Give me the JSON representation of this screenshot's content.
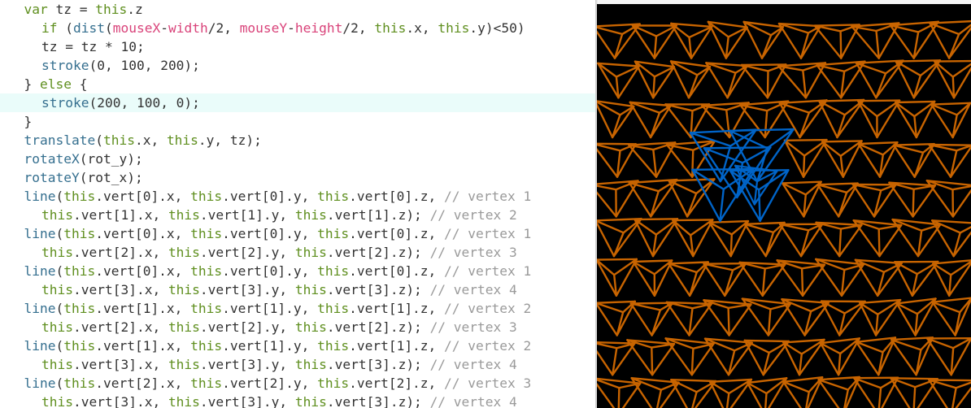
{
  "editor": {
    "active_line_index": 5,
    "lines": [
      {
        "indent": 1,
        "tokens": [
          {
            "t": "kw",
            "v": "var"
          },
          {
            "t": "pl",
            "v": " tz = "
          },
          {
            "t": "kw",
            "v": "this"
          },
          {
            "t": "pl",
            "v": ".z"
          }
        ]
      },
      {
        "indent": 2,
        "tokens": [
          {
            "t": "kw",
            "v": "if"
          },
          {
            "t": "pl",
            "v": " ("
          },
          {
            "t": "fn",
            "v": "dist"
          },
          {
            "t": "pl",
            "v": "("
          },
          {
            "t": "pk",
            "v": "mouseX"
          },
          {
            "t": "pl",
            "v": "-"
          },
          {
            "t": "pk",
            "v": "width"
          },
          {
            "t": "pl",
            "v": "/2, "
          },
          {
            "t": "pk",
            "v": "mouseY"
          },
          {
            "t": "pl",
            "v": "-"
          },
          {
            "t": "pk",
            "v": "height"
          },
          {
            "t": "pl",
            "v": "/2, "
          },
          {
            "t": "kw",
            "v": "this"
          },
          {
            "t": "pl",
            "v": ".x, "
          },
          {
            "t": "kw",
            "v": "this"
          },
          {
            "t": "pl",
            "v": ".y)<50)"
          }
        ]
      },
      {
        "indent": 2,
        "tokens": [
          {
            "t": "pl",
            "v": "tz = tz * 10;"
          }
        ]
      },
      {
        "indent": 2,
        "tokens": [
          {
            "t": "fn",
            "v": "stroke"
          },
          {
            "t": "pl",
            "v": "(0, 100, 200);"
          }
        ]
      },
      {
        "indent": 1,
        "tokens": [
          {
            "t": "pl",
            "v": "} "
          },
          {
            "t": "kw",
            "v": "else"
          },
          {
            "t": "pl",
            "v": " {"
          }
        ]
      },
      {
        "indent": 2,
        "tokens": [
          {
            "t": "fn",
            "v": "stroke"
          },
          {
            "t": "pl",
            "v": "(200, 100, 0);"
          }
        ]
      },
      {
        "indent": 1,
        "tokens": [
          {
            "t": "pl",
            "v": "}"
          }
        ]
      },
      {
        "indent": 1,
        "tokens": [
          {
            "t": "fn",
            "v": "translate"
          },
          {
            "t": "pl",
            "v": "("
          },
          {
            "t": "kw",
            "v": "this"
          },
          {
            "t": "pl",
            "v": ".x, "
          },
          {
            "t": "kw",
            "v": "this"
          },
          {
            "t": "pl",
            "v": ".y, tz);"
          }
        ]
      },
      {
        "indent": 1,
        "tokens": [
          {
            "t": "fn",
            "v": "rotateX"
          },
          {
            "t": "pl",
            "v": "(rot_y);"
          }
        ]
      },
      {
        "indent": 1,
        "tokens": [
          {
            "t": "fn",
            "v": "rotateY"
          },
          {
            "t": "pl",
            "v": "(rot_x);"
          }
        ]
      },
      {
        "indent": 1,
        "tokens": [
          {
            "t": "fn",
            "v": "line"
          },
          {
            "t": "pl",
            "v": "("
          },
          {
            "t": "kw",
            "v": "this"
          },
          {
            "t": "pl",
            "v": ".vert[0].x, "
          },
          {
            "t": "kw",
            "v": "this"
          },
          {
            "t": "pl",
            "v": ".vert[0].y, "
          },
          {
            "t": "kw",
            "v": "this"
          },
          {
            "t": "pl",
            "v": ".vert[0].z, "
          },
          {
            "t": "cm",
            "v": "// vertex 1"
          }
        ]
      },
      {
        "indent": 2,
        "tokens": [
          {
            "t": "kw",
            "v": "this"
          },
          {
            "t": "pl",
            "v": ".vert[1].x, "
          },
          {
            "t": "kw",
            "v": "this"
          },
          {
            "t": "pl",
            "v": ".vert[1].y, "
          },
          {
            "t": "kw",
            "v": "this"
          },
          {
            "t": "pl",
            "v": ".vert[1].z); "
          },
          {
            "t": "cm",
            "v": "// vertex 2"
          }
        ]
      },
      {
        "indent": 1,
        "tokens": [
          {
            "t": "fn",
            "v": "line"
          },
          {
            "t": "pl",
            "v": "("
          },
          {
            "t": "kw",
            "v": "this"
          },
          {
            "t": "pl",
            "v": ".vert[0].x, "
          },
          {
            "t": "kw",
            "v": "this"
          },
          {
            "t": "pl",
            "v": ".vert[0].y, "
          },
          {
            "t": "kw",
            "v": "this"
          },
          {
            "t": "pl",
            "v": ".vert[0].z, "
          },
          {
            "t": "cm",
            "v": "// vertex 1"
          }
        ]
      },
      {
        "indent": 2,
        "tokens": [
          {
            "t": "kw",
            "v": "this"
          },
          {
            "t": "pl",
            "v": ".vert[2].x, "
          },
          {
            "t": "kw",
            "v": "this"
          },
          {
            "t": "pl",
            "v": ".vert[2].y, "
          },
          {
            "t": "kw",
            "v": "this"
          },
          {
            "t": "pl",
            "v": ".vert[2].z); "
          },
          {
            "t": "cm",
            "v": "// vertex 3"
          }
        ]
      },
      {
        "indent": 1,
        "tokens": [
          {
            "t": "fn",
            "v": "line"
          },
          {
            "t": "pl",
            "v": "("
          },
          {
            "t": "kw",
            "v": "this"
          },
          {
            "t": "pl",
            "v": ".vert[0].x, "
          },
          {
            "t": "kw",
            "v": "this"
          },
          {
            "t": "pl",
            "v": ".vert[0].y, "
          },
          {
            "t": "kw",
            "v": "this"
          },
          {
            "t": "pl",
            "v": ".vert[0].z, "
          },
          {
            "t": "cm",
            "v": "// vertex 1"
          }
        ]
      },
      {
        "indent": 2,
        "tokens": [
          {
            "t": "kw",
            "v": "this"
          },
          {
            "t": "pl",
            "v": ".vert[3].x, "
          },
          {
            "t": "kw",
            "v": "this"
          },
          {
            "t": "pl",
            "v": ".vert[3].y, "
          },
          {
            "t": "kw",
            "v": "this"
          },
          {
            "t": "pl",
            "v": ".vert[3].z); "
          },
          {
            "t": "cm",
            "v": "// vertex 4"
          }
        ]
      },
      {
        "indent": 1,
        "tokens": [
          {
            "t": "fn",
            "v": "line"
          },
          {
            "t": "pl",
            "v": "("
          },
          {
            "t": "kw",
            "v": "this"
          },
          {
            "t": "pl",
            "v": ".vert[1].x, "
          },
          {
            "t": "kw",
            "v": "this"
          },
          {
            "t": "pl",
            "v": ".vert[1].y, "
          },
          {
            "t": "kw",
            "v": "this"
          },
          {
            "t": "pl",
            "v": ".vert[1].z, "
          },
          {
            "t": "cm",
            "v": "// vertex 2"
          }
        ]
      },
      {
        "indent": 2,
        "tokens": [
          {
            "t": "kw",
            "v": "this"
          },
          {
            "t": "pl",
            "v": ".vert[2].x, "
          },
          {
            "t": "kw",
            "v": "this"
          },
          {
            "t": "pl",
            "v": ".vert[2].y, "
          },
          {
            "t": "kw",
            "v": "this"
          },
          {
            "t": "pl",
            "v": ".vert[2].z); "
          },
          {
            "t": "cm",
            "v": "// vertex 3"
          }
        ]
      },
      {
        "indent": 1,
        "tokens": [
          {
            "t": "fn",
            "v": "line"
          },
          {
            "t": "pl",
            "v": "("
          },
          {
            "t": "kw",
            "v": "this"
          },
          {
            "t": "pl",
            "v": ".vert[1].x, "
          },
          {
            "t": "kw",
            "v": "this"
          },
          {
            "t": "pl",
            "v": ".vert[1].y, "
          },
          {
            "t": "kw",
            "v": "this"
          },
          {
            "t": "pl",
            "v": ".vert[1].z, "
          },
          {
            "t": "cm",
            "v": "// vertex 2"
          }
        ]
      },
      {
        "indent": 2,
        "tokens": [
          {
            "t": "kw",
            "v": "this"
          },
          {
            "t": "pl",
            "v": ".vert[3].x, "
          },
          {
            "t": "kw",
            "v": "this"
          },
          {
            "t": "pl",
            "v": ".vert[3].y, "
          },
          {
            "t": "kw",
            "v": "this"
          },
          {
            "t": "pl",
            "v": ".vert[3].z); "
          },
          {
            "t": "cm",
            "v": "// vertex 4"
          }
        ]
      },
      {
        "indent": 1,
        "tokens": [
          {
            "t": "fn",
            "v": "line"
          },
          {
            "t": "pl",
            "v": "("
          },
          {
            "t": "kw",
            "v": "this"
          },
          {
            "t": "pl",
            "v": ".vert[2].x, "
          },
          {
            "t": "kw",
            "v": "this"
          },
          {
            "t": "pl",
            "v": ".vert[2].y, "
          },
          {
            "t": "kw",
            "v": "this"
          },
          {
            "t": "pl",
            "v": ".vert[2].z, "
          },
          {
            "t": "cm",
            "v": "// vertex 3"
          }
        ]
      },
      {
        "indent": 2,
        "tokens": [
          {
            "t": "kw",
            "v": "this"
          },
          {
            "t": "pl",
            "v": ".vert[3].x, "
          },
          {
            "t": "kw",
            "v": "this"
          },
          {
            "t": "pl",
            "v": ".vert[3].y, "
          },
          {
            "t": "kw",
            "v": "this"
          },
          {
            "t": "pl",
            "v": ".vert[3].z); "
          },
          {
            "t": "cm",
            "v": "// vertex 4"
          }
        ]
      }
    ]
  },
  "sketch": {
    "background": "#000000",
    "default_stroke": "#c86400",
    "highlight_stroke": "#0064c8",
    "grid_cols": 10,
    "grid_rows": 10
  },
  "colors": {
    "keyword": "#5f8f1f",
    "function": "#356f8f",
    "builtin_var": "#d9437a",
    "comment": "#9a9a9a",
    "active_line": "#eafcfa"
  }
}
